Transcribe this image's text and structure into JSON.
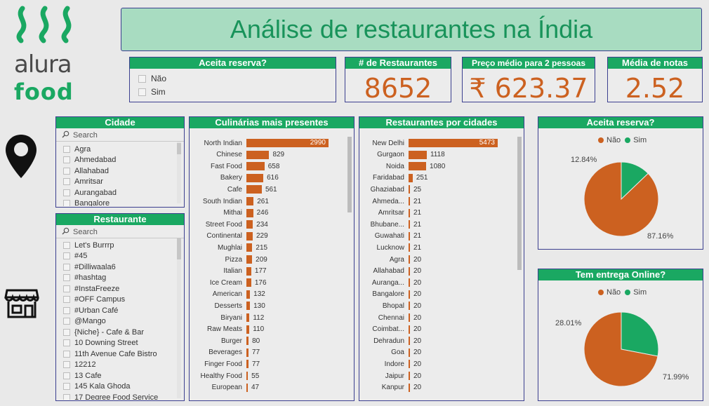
{
  "brand": {
    "line1": "alura",
    "line2": "food"
  },
  "title": "Análise de restaurantes na Índia",
  "filter_reserva": {
    "title": "Aceita reserva?",
    "options": [
      "Não",
      "Sim"
    ]
  },
  "kpis": {
    "restaurantes": {
      "title": "# de Restaurantes",
      "value": "8652"
    },
    "preco": {
      "title": "Preço médio para 2 pessoas",
      "value": "₹ 623.37"
    },
    "notas": {
      "title": "Média de notas",
      "value": "2.52"
    }
  },
  "cidade_slicer": {
    "title": "Cidade",
    "search_placeholder": "Search",
    "items": [
      "Agra",
      "Ahmedabad",
      "Allahabad",
      "Amritsar",
      "Aurangabad",
      "Bangalore"
    ]
  },
  "restaurante_slicer": {
    "title": "Restaurante",
    "search_placeholder": "Search",
    "items": [
      "Let's Burrrp",
      "#45",
      "#Dilliwaala6",
      "#hashtag",
      "#InstaFreeze",
      "#OFF Campus",
      "#Urban Café",
      "@Mango",
      "{Niche} - Cafe & Bar",
      "10 Downing Street",
      "11th Avenue Cafe Bistro",
      "12212",
      "13 Cafe",
      "145 Kala Ghoda",
      "17 Degree Food Service"
    ]
  },
  "culinarias": {
    "title": "Culinárias mais presentes",
    "bar_color": "#cc6120",
    "categories": [
      "North Indian",
      "Chinese",
      "Fast Food",
      "Bakery",
      "Cafe",
      "South Indian",
      "Mithai",
      "Street Food",
      "Continental",
      "Mughlai",
      "Pizza",
      "Italian",
      "Ice Cream",
      "American",
      "Desserts",
      "Biryani",
      "Raw Meats",
      "Burger",
      "Beverages",
      "Finger Food",
      "Healthy Food",
      "European"
    ],
    "values": [
      2990,
      829,
      658,
      616,
      561,
      261,
      246,
      234,
      229,
      215,
      209,
      177,
      176,
      132,
      130,
      112,
      110,
      80,
      77,
      77,
      55,
      47
    ]
  },
  "cidades": {
    "title": "Restaurantes por cidades",
    "bar_color": "#cc6120",
    "categories": [
      "New Delhi",
      "Gurgaon",
      "Noida",
      "Faridabad",
      "Ghaziabad",
      "Ahmeda...",
      "Amritsar",
      "Bhubane...",
      "Guwahati",
      "Lucknow",
      "Agra",
      "Allahabad",
      "Auranga...",
      "Bangalore",
      "Bhopal",
      "Chennai",
      "Coimbat...",
      "Dehradun",
      "Goa",
      "Indore",
      "Jaipur",
      "Kanpur"
    ],
    "values": [
      5473,
      1118,
      1080,
      251,
      25,
      21,
      21,
      21,
      21,
      21,
      20,
      20,
      20,
      20,
      20,
      20,
      20,
      20,
      20,
      20,
      20,
      20
    ]
  },
  "pie_reserva": {
    "title": "Aceita reserva?",
    "legend": [
      "Não",
      "Sim"
    ],
    "colors": [
      "#cc6120",
      "#1aa862"
    ],
    "values": [
      87.16,
      12.84
    ],
    "labels": [
      "87.16%",
      "12.84%"
    ]
  },
  "pie_entrega": {
    "title": "Tem entrega Online?",
    "legend": [
      "Não",
      "Sim"
    ],
    "colors": [
      "#cc6120",
      "#1aa862"
    ],
    "values": [
      71.99,
      28.01
    ],
    "labels": [
      "71.99%",
      "28.01%"
    ]
  }
}
